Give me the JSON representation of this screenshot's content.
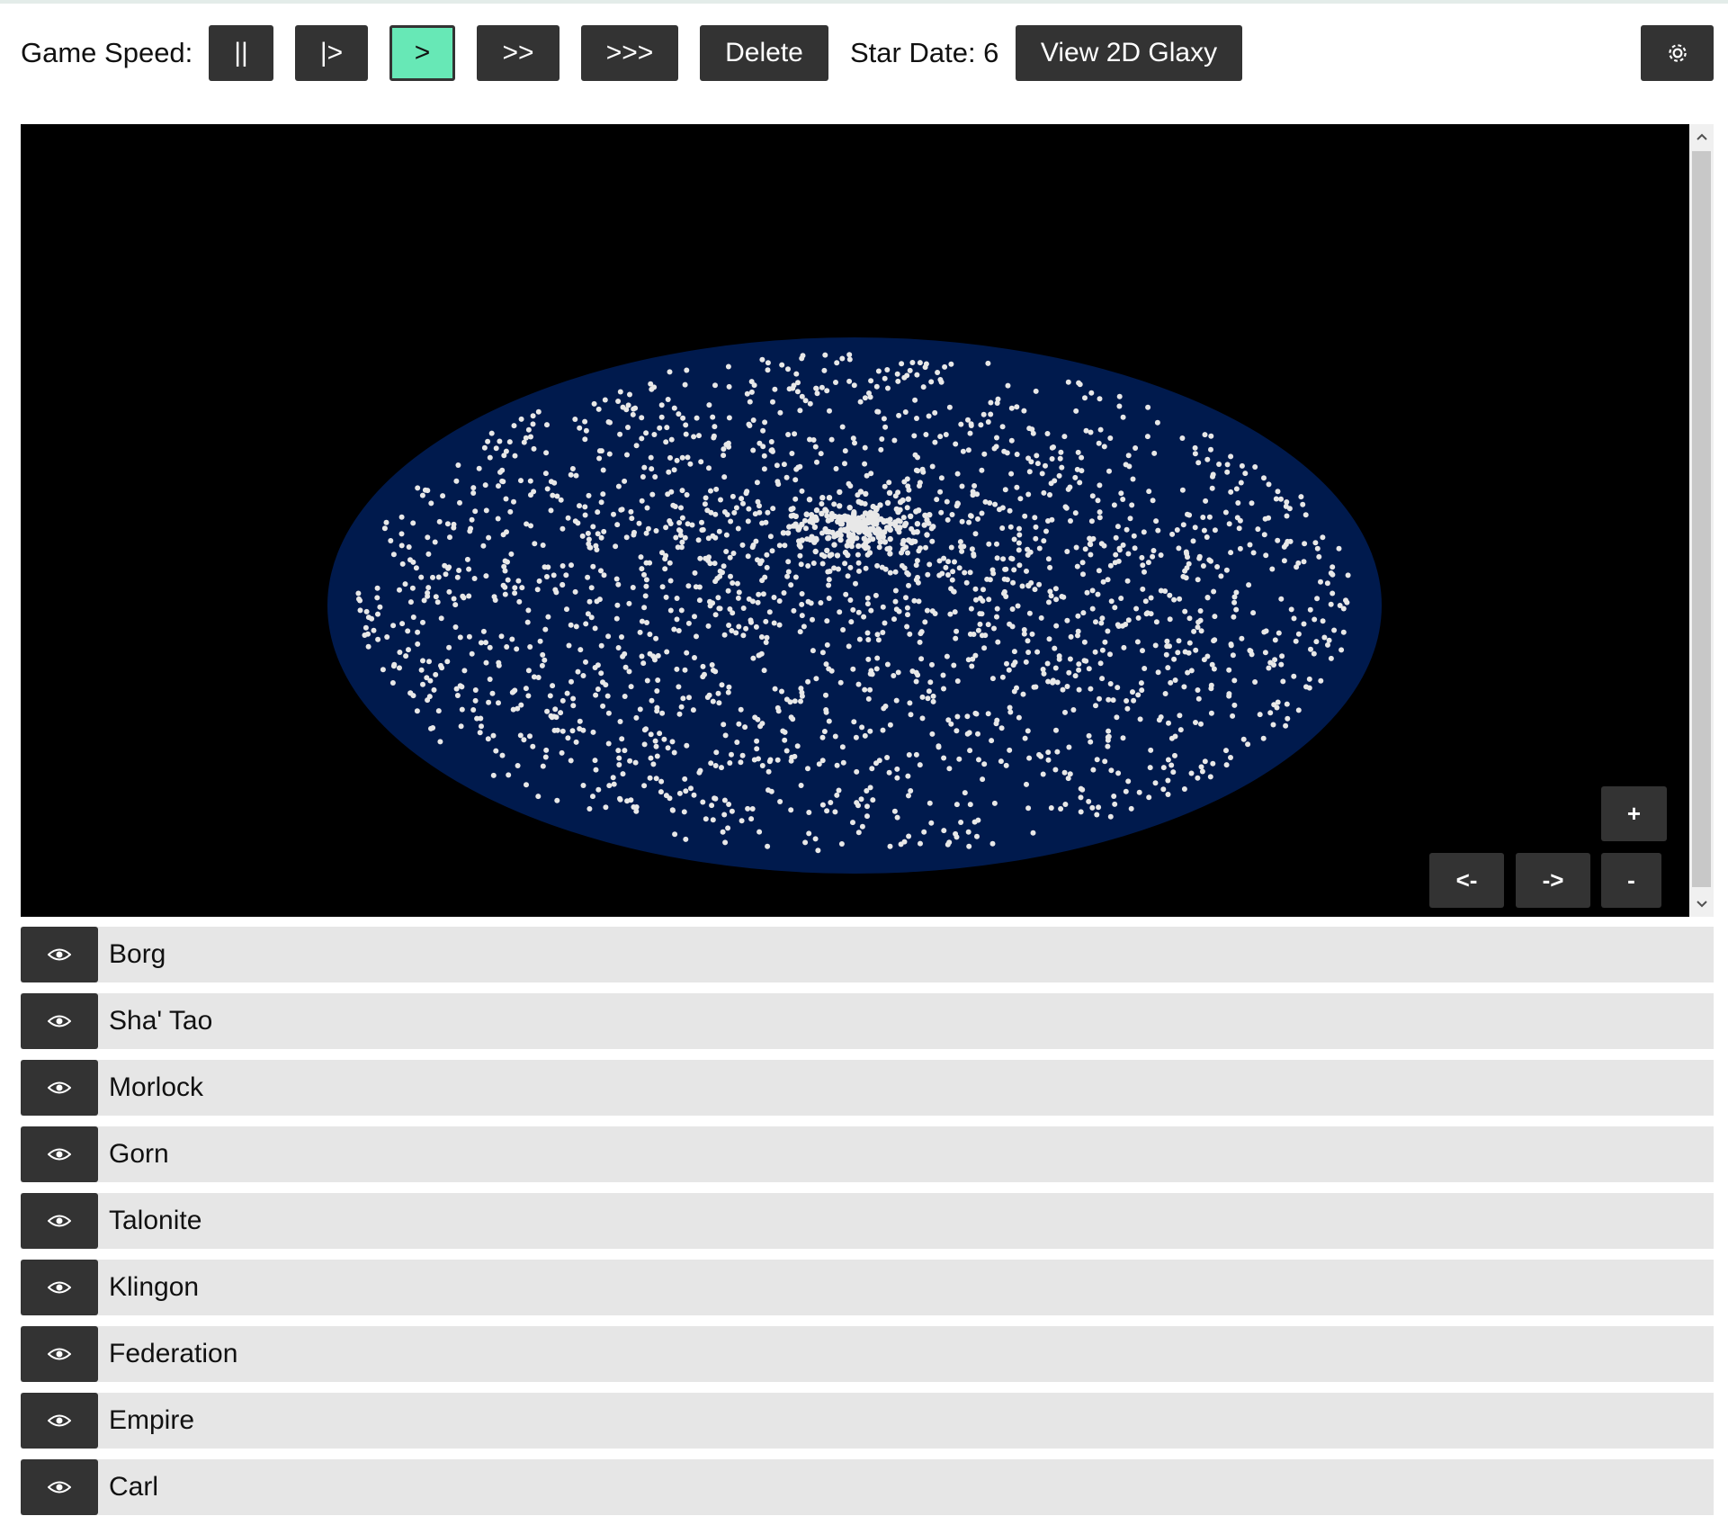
{
  "toolbar": {
    "game_speed_label": "Game Speed:",
    "speed_buttons": [
      "||",
      "|>",
      ">",
      ">>",
      ">>>"
    ],
    "active_speed": ">",
    "delete_label": "Delete",
    "star_date_label": "Star Date: 6",
    "view_2d_label": "View 2D Glaxy",
    "settings_icon": "gear-icon"
  },
  "galaxy_view": {
    "disc_color": "#001a4d",
    "star_color": "#e8e8e8",
    "background": "#000000",
    "controls": {
      "zoom_in": "+",
      "rotate_left": "<-",
      "rotate_right": "->",
      "zoom_out": "-"
    }
  },
  "empires": [
    {
      "name": "Borg",
      "icon": "eye-icon"
    },
    {
      "name": "Sha' Tao",
      "icon": "eye-icon"
    },
    {
      "name": "Morlock",
      "icon": "eye-icon"
    },
    {
      "name": "Gorn",
      "icon": "eye-icon"
    },
    {
      "name": "Talonite",
      "icon": "eye-icon"
    },
    {
      "name": "Klingon",
      "icon": "eye-icon"
    },
    {
      "name": "Federation",
      "icon": "eye-icon"
    },
    {
      "name": "Empire",
      "icon": "eye-icon"
    },
    {
      "name": "Carl",
      "icon": "eye-icon"
    }
  ],
  "colors": {
    "button_dark": "#333333",
    "button_active": "#67e8b6",
    "row_bg": "#e6e6e6"
  }
}
